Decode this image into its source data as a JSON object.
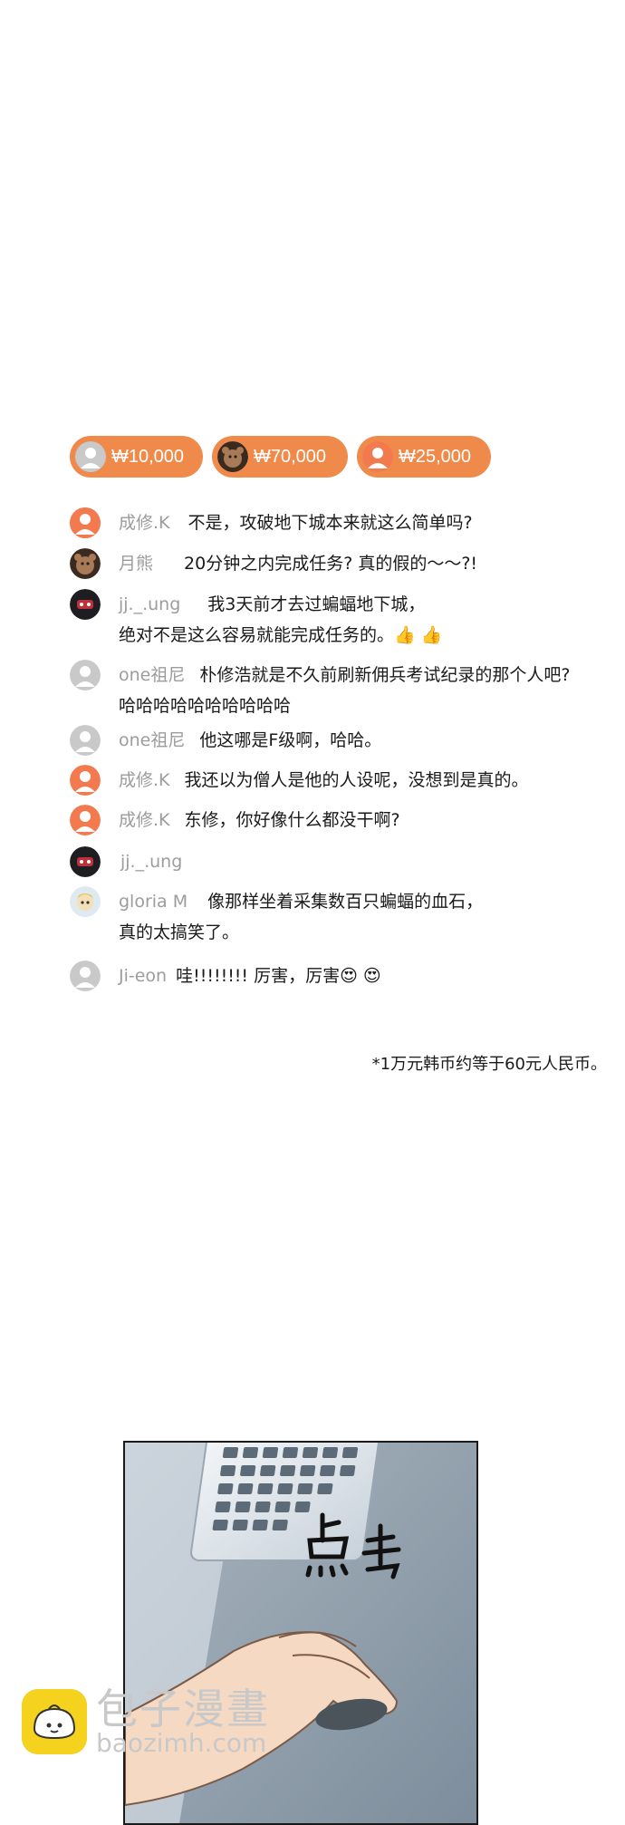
{
  "donations": [
    {
      "amount": "₩10,000",
      "avatar": "gray"
    },
    {
      "amount": "₩70,000",
      "avatar": "bear"
    },
    {
      "amount": "₩25,000",
      "avatar": "orange"
    }
  ],
  "comments": [
    {
      "user": "成修.K",
      "text": "不是，攻破地下城本来就这么简单吗?",
      "text2": "",
      "avatar": "orange"
    },
    {
      "user": "月熊",
      "text": "20分钟之内完成任务? 真的假的～～?!",
      "text2": "",
      "avatar": "bear"
    },
    {
      "user": "jj._.ung",
      "text": "我3天前才去过蝙蝠地下城，",
      "text2": "绝对不是这么容易就能完成任务的。👍 👍",
      "avatar": "mask"
    },
    {
      "user": "one祖尼",
      "text": "朴修浩就是不久前刷新佣兵考试纪录的那个人吧?",
      "text2": "哈哈哈哈哈哈哈哈哈哈",
      "avatar": "gray"
    },
    {
      "user": "one祖尼",
      "text": "他这哪是F级啊，哈哈。",
      "text2": "",
      "avatar": "gray"
    },
    {
      "user": "成修.K",
      "text": "我还以为僧人是他的人设呢，没想到是真的。",
      "text2": "",
      "avatar": "orange"
    },
    {
      "user": "成修.K",
      "text": "东修，你好像什么都没干啊?",
      "text2": "",
      "avatar": "orange"
    },
    {
      "user": "jj._.ung",
      "text": "",
      "text2": "",
      "avatar": "mask"
    },
    {
      "user": "gloria M",
      "text": "像那样坐着采集数百只蝙蝠的血石，",
      "text2": "真的太搞笑了。",
      "avatar": "cartoon"
    },
    {
      "user": "Ji-eon",
      "text": "哇!!!!!!!! 厉害，厉害😍 😍",
      "text2": "",
      "avatar": "gray"
    }
  ],
  "note": "*1万元韩币约等于60元人民币。",
  "panel": {
    "sfx": "点击"
  },
  "watermark": {
    "title": "包子漫畫",
    "url": "baozimh.com"
  }
}
